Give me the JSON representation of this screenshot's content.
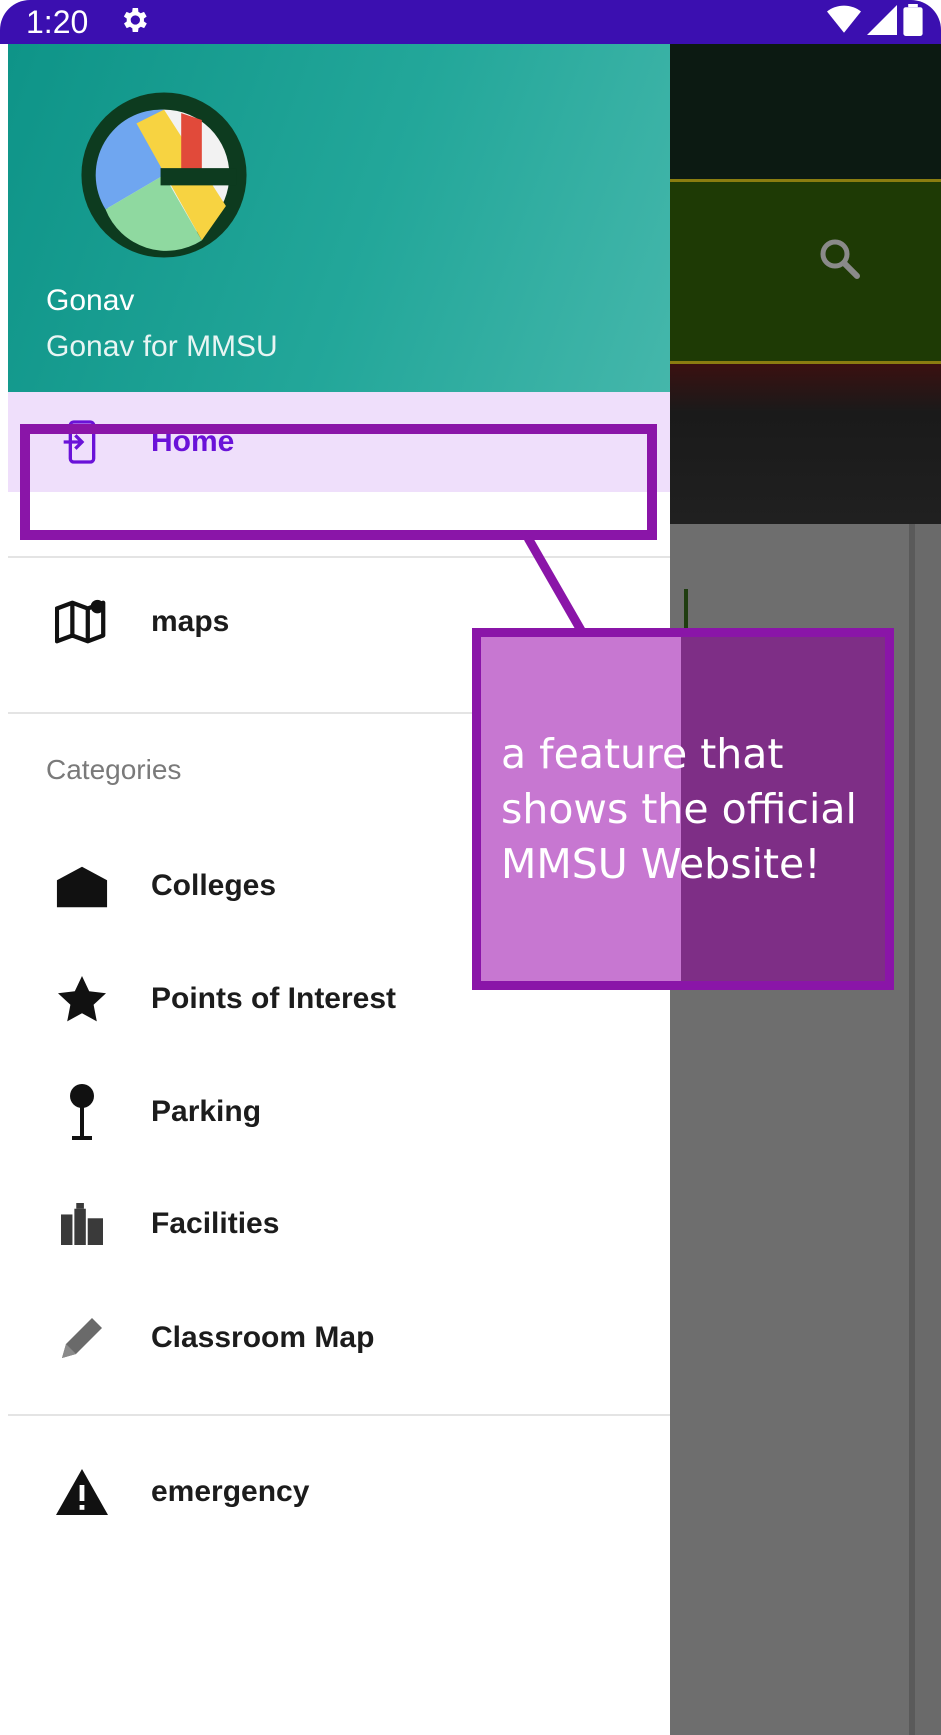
{
  "status_bar": {
    "time": "1:20"
  },
  "drawer": {
    "header": {
      "title": "Gonav",
      "subtitle": "Gonav for MMSU"
    },
    "items": [
      {
        "label": "Home",
        "icon": "exit-to-app-icon",
        "selected": true
      },
      {
        "label": "maps",
        "icon": "map-icon",
        "selected": false
      }
    ],
    "section_label": "Categories",
    "category_items": [
      {
        "label": "Colleges",
        "icon": "college-icon"
      },
      {
        "label": "Points of Interest",
        "icon": "star-icon"
      },
      {
        "label": "Parking",
        "icon": "pin-icon"
      },
      {
        "label": "Facilities",
        "icon": "facilities-icon"
      },
      {
        "label": "Classroom Map",
        "icon": "pencil-icon"
      }
    ],
    "footer_items": [
      {
        "label": "emergency",
        "icon": "warning-icon"
      }
    ]
  },
  "annotation": {
    "text": "a feature that shows the official MMSU Website!"
  },
  "colors": {
    "status_bar": "#3b0fb0",
    "header_start": "#0e9488",
    "header_end": "#45b7ab",
    "selected_bg": "#efdffb",
    "selected_text": "#6a12d8",
    "annotation_border": "#8a15a8",
    "annotation_fill_light": "#c777d1",
    "annotation_fill_dark": "#7e2e86"
  }
}
